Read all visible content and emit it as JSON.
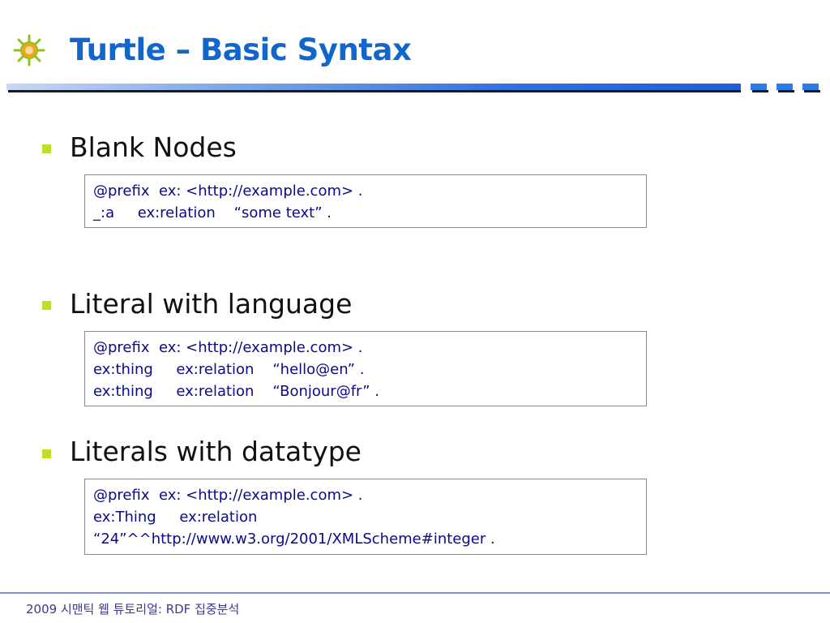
{
  "slide": {
    "title": "Turtle – Basic Syntax",
    "logo_icon": "sun-bug-icon"
  },
  "colors": {
    "title": "#1166cc",
    "bullet": "#bde02a",
    "code_text": "#0a0a8a",
    "rule": "#2e6fe0",
    "footer": "#3a3a8a"
  },
  "sections": [
    {
      "heading": "Blank Nodes",
      "code": [
        "@prefix  ex: <http://example.com> .",
        "_:a     ex:relation    “some text” ."
      ]
    },
    {
      "heading": "Literal with language",
      "code": [
        "@prefix  ex: <http://example.com> .",
        "ex:thing     ex:relation    “hello@en” .",
        "ex:thing     ex:relation    “Bonjour@fr” ."
      ]
    },
    {
      "heading": "Literals with datatype",
      "code": [
        "@prefix  ex: <http://example.com> .",
        "ex:Thing     ex:relation",
        "“24”^^http://www.w3.org/2001/XMLScheme#integer ."
      ]
    }
  ],
  "footer": {
    "text": "2009 시맨틱 웹 튜토리얼: RDF 집중분석"
  }
}
